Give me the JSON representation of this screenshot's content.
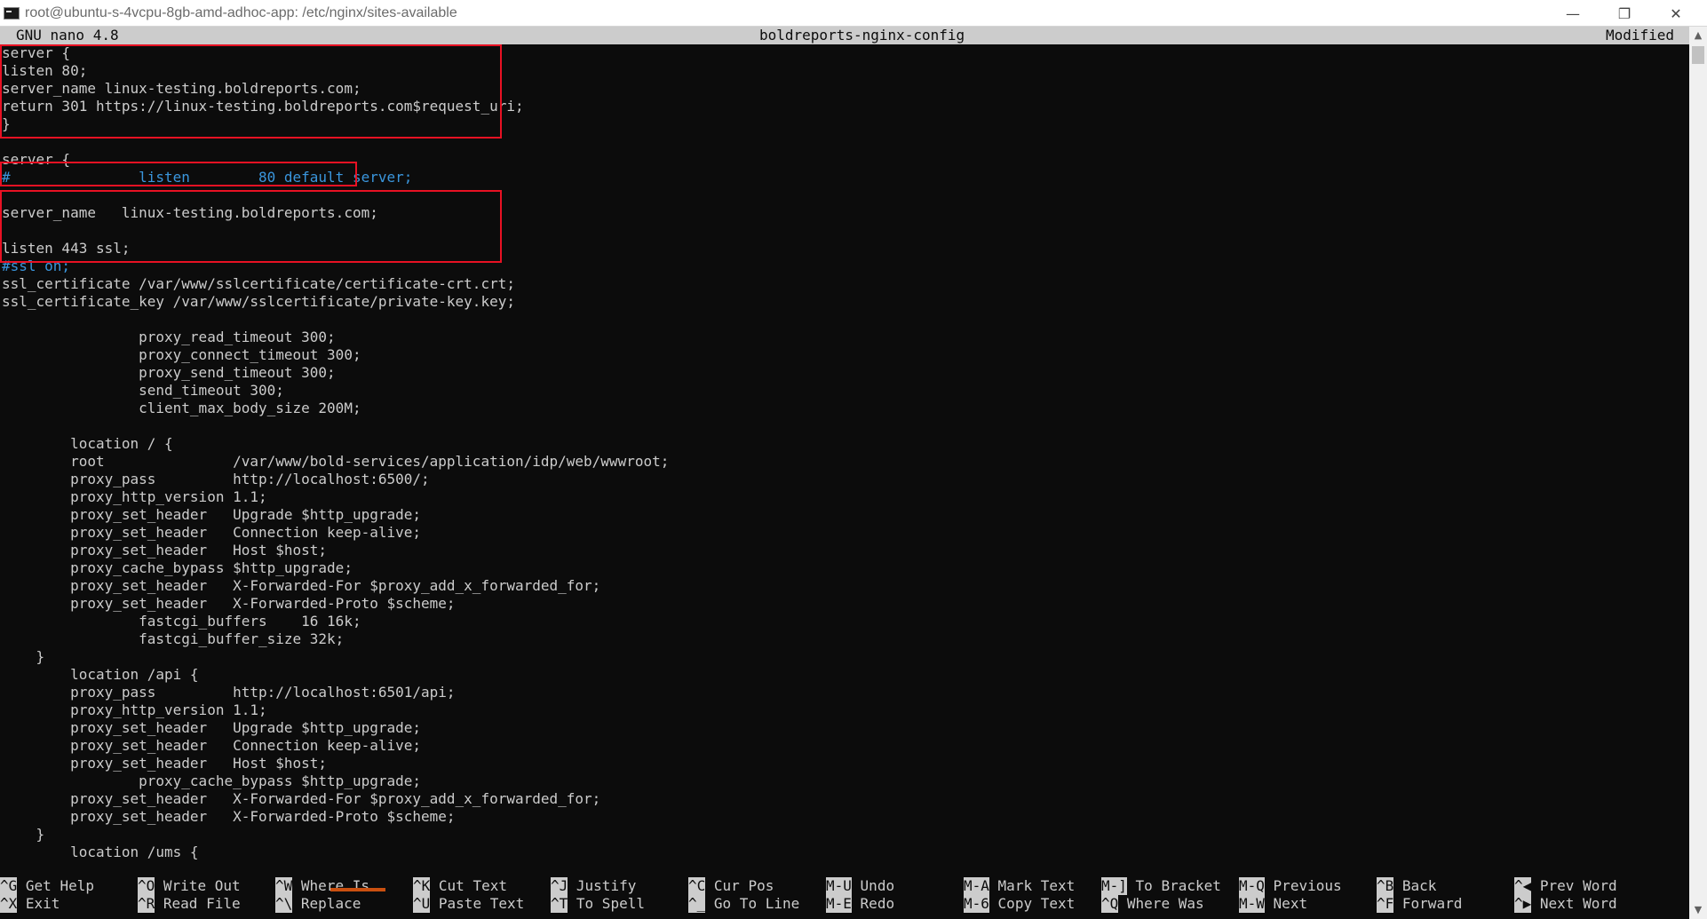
{
  "window": {
    "title": "root@ubuntu-s-4vcpu-8gb-amd-adhoc-app: /etc/nginx/sites-available",
    "icon": "terminal-icon",
    "minimize_glyph": "—",
    "restore_glyph": "❐",
    "close_glyph": "✕"
  },
  "nano": {
    "version": "GNU nano 4.8",
    "filename": "boldreports-nginx-config",
    "status": "Modified"
  },
  "editor": {
    "lines": [
      {
        "segments": [
          {
            "text": "server {",
            "comment": false
          }
        ]
      },
      {
        "segments": [
          {
            "text": "listen 80;",
            "comment": false
          }
        ]
      },
      {
        "segments": [
          {
            "text": "server_name linux-testing.boldreports.com;",
            "comment": false
          }
        ]
      },
      {
        "segments": [
          {
            "text": "return 301 https://linux-testing.boldreports.com$request_uri;",
            "comment": false
          }
        ]
      },
      {
        "segments": [
          {
            "text": "}",
            "comment": false
          }
        ]
      },
      {
        "segments": []
      },
      {
        "segments": [
          {
            "text": "server {",
            "comment": false
          }
        ]
      },
      {
        "segments": [
          {
            "text": "#               listen        80 default_server;",
            "comment": true
          }
        ]
      },
      {
        "segments": []
      },
      {
        "segments": [
          {
            "text": "server_name   linux-testing.boldreports.com;",
            "comment": false
          }
        ]
      },
      {
        "segments": []
      },
      {
        "segments": [
          {
            "text": "listen 443 ssl;",
            "comment": false
          }
        ]
      },
      {
        "segments": [
          {
            "text": "#ssl on;",
            "comment": true
          }
        ]
      },
      {
        "segments": [
          {
            "text": "ssl_certificate /var/www/sslcertificate/certificate-crt.crt;",
            "comment": false
          }
        ]
      },
      {
        "segments": [
          {
            "text": "ssl_certificate_key /var/www/sslcertificate/private-key.key;",
            "comment": false
          }
        ]
      },
      {
        "segments": []
      },
      {
        "segments": [
          {
            "text": "                proxy_read_timeout 300;",
            "comment": false
          }
        ]
      },
      {
        "segments": [
          {
            "text": "                proxy_connect_timeout 300;",
            "comment": false
          }
        ]
      },
      {
        "segments": [
          {
            "text": "                proxy_send_timeout 300;",
            "comment": false
          }
        ]
      },
      {
        "segments": [
          {
            "text": "                send_timeout 300;",
            "comment": false
          }
        ]
      },
      {
        "segments": [
          {
            "text": "                client_max_body_size 200M;",
            "comment": false
          }
        ]
      },
      {
        "segments": []
      },
      {
        "segments": [
          {
            "text": "        location / {",
            "comment": false
          }
        ]
      },
      {
        "segments": [
          {
            "text": "        root               /var/www/bold-services/application/idp/web/wwwroot;",
            "comment": false
          }
        ]
      },
      {
        "segments": [
          {
            "text": "        proxy_pass         http://localhost:6500/;",
            "comment": false
          }
        ]
      },
      {
        "segments": [
          {
            "text": "        proxy_http_version 1.1;",
            "comment": false
          }
        ]
      },
      {
        "segments": [
          {
            "text": "        proxy_set_header   Upgrade $http_upgrade;",
            "comment": false
          }
        ]
      },
      {
        "segments": [
          {
            "text": "        proxy_set_header   Connection keep-alive;",
            "comment": false
          }
        ]
      },
      {
        "segments": [
          {
            "text": "        proxy_set_header   Host $host;",
            "comment": false
          }
        ]
      },
      {
        "segments": [
          {
            "text": "        proxy_cache_bypass $http_upgrade;",
            "comment": false
          }
        ]
      },
      {
        "segments": [
          {
            "text": "        proxy_set_header   X-Forwarded-For $proxy_add_x_forwarded_for;",
            "comment": false
          }
        ]
      },
      {
        "segments": [
          {
            "text": "        proxy_set_header   X-Forwarded-Proto $scheme;",
            "comment": false
          }
        ]
      },
      {
        "segments": [
          {
            "text": "                fastcgi_buffers    16 16k;",
            "comment": false
          }
        ]
      },
      {
        "segments": [
          {
            "text": "                fastcgi_buffer_size 32k;",
            "comment": false
          }
        ]
      },
      {
        "segments": [
          {
            "text": "    }",
            "comment": false
          }
        ]
      },
      {
        "segments": [
          {
            "text": "        location /api {",
            "comment": false
          }
        ]
      },
      {
        "segments": [
          {
            "text": "        proxy_pass         http://localhost:6501/api;",
            "comment": false
          }
        ]
      },
      {
        "segments": [
          {
            "text": "        proxy_http_version 1.1;",
            "comment": false
          }
        ]
      },
      {
        "segments": [
          {
            "text": "        proxy_set_header   Upgrade $http_upgrade;",
            "comment": false
          }
        ]
      },
      {
        "segments": [
          {
            "text": "        proxy_set_header   Connection keep-alive;",
            "comment": false
          }
        ]
      },
      {
        "segments": [
          {
            "text": "        proxy_set_header   Host $host;",
            "comment": false
          }
        ]
      },
      {
        "segments": [
          {
            "text": "                proxy_cache_bypass $http_upgrade;",
            "comment": false
          }
        ]
      },
      {
        "segments": [
          {
            "text": "        proxy_set_header   X-Forwarded-For $proxy_add_x_forwarded_for;",
            "comment": false
          }
        ]
      },
      {
        "segments": [
          {
            "text": "        proxy_set_header   X-Forwarded-Proto $scheme;",
            "comment": false
          }
        ]
      },
      {
        "segments": [
          {
            "text": "    }",
            "comment": false
          }
        ]
      },
      {
        "segments": [
          {
            "text": "        location /ums {",
            "comment": false
          }
        ]
      }
    ]
  },
  "shortcuts": [
    {
      "key": "^G",
      "label": "Get Help"
    },
    {
      "key": "^X",
      "label": "Exit"
    },
    {
      "key": "^O",
      "label": "Write Out"
    },
    {
      "key": "^R",
      "label": "Read File"
    },
    {
      "key": "^W",
      "label": "Where Is"
    },
    {
      "key": "^\\",
      "label": "Replace"
    },
    {
      "key": "^K",
      "label": "Cut Text"
    },
    {
      "key": "^U",
      "label": "Paste Text"
    },
    {
      "key": "^J",
      "label": "Justify"
    },
    {
      "key": "^T",
      "label": "To Spell"
    },
    {
      "key": "^C",
      "label": "Cur Pos"
    },
    {
      "key": "^_",
      "label": "Go To Line"
    },
    {
      "key": "M-U",
      "label": "Undo"
    },
    {
      "key": "M-E",
      "label": "Redo"
    },
    {
      "key": "M-A",
      "label": "Mark Text"
    },
    {
      "key": "M-6",
      "label": "Copy Text"
    },
    {
      "key": "M-]",
      "label": "To Bracket"
    },
    {
      "key": "^Q",
      "label": "Where Was"
    },
    {
      "key": "M-Q",
      "label": "Previous"
    },
    {
      "key": "M-W",
      "label": "Next"
    },
    {
      "key": "^B",
      "label": "Back"
    },
    {
      "key": "^F",
      "label": "Forward"
    },
    {
      "key": "^◀",
      "label": "Prev Word"
    },
    {
      "key": "^▶",
      "label": "Next Word"
    }
  ],
  "colors": {
    "background": "#0c0c0c",
    "text": "#cccccc",
    "comment": "#3a96dd",
    "header_bg": "#cccccc",
    "highlight_border": "#e81123",
    "cursor": "#ca5010"
  }
}
